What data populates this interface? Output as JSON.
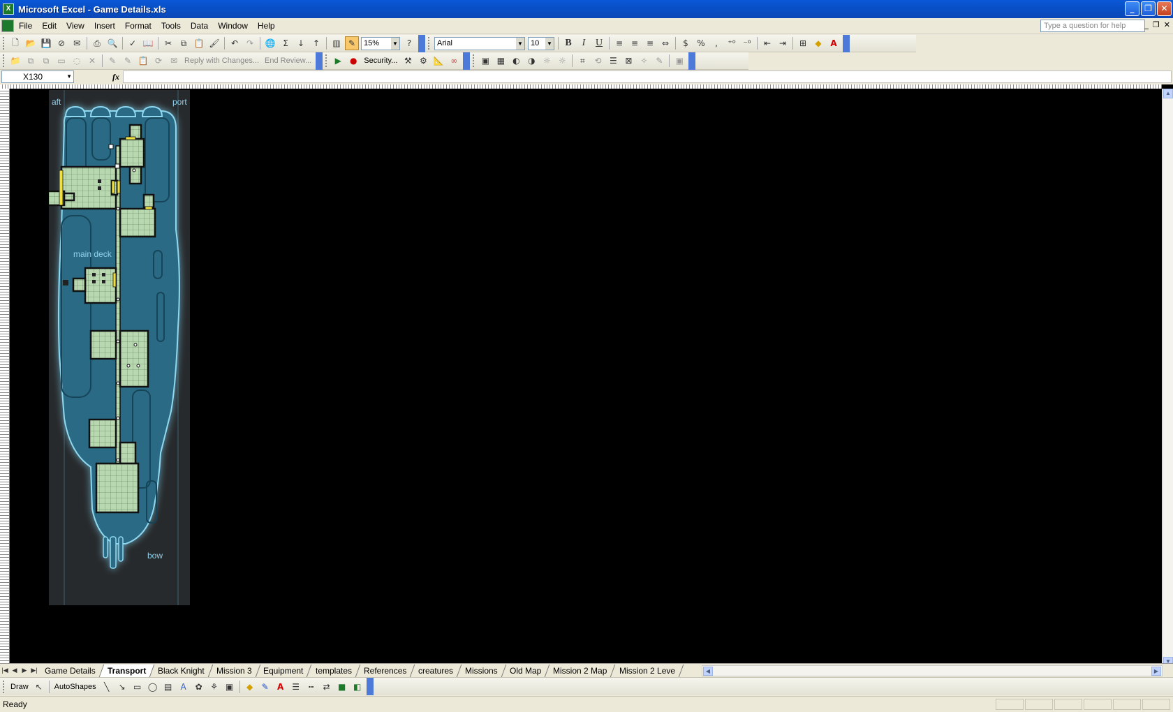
{
  "window": {
    "title": "Microsoft Excel - Game Details.xls",
    "app_icon": "X"
  },
  "menu": [
    "File",
    "Edit",
    "View",
    "Insert",
    "Format",
    "Tools",
    "Data",
    "Window",
    "Help"
  ],
  "help_placeholder": "Type a question for help",
  "standard_toolbar": {
    "zoom": "15%"
  },
  "formatting_toolbar": {
    "font": "Arial",
    "size": "10",
    "bold": "B",
    "italic": "I",
    "underline": "U",
    "percent": "%",
    "comma": ","
  },
  "reviewing_toolbar": {
    "reply": "Reply with Changes...",
    "end_review": "End Review...",
    "security": "Security..."
  },
  "formula_bar": {
    "name_box": "X130",
    "fx": "fx",
    "formula": ""
  },
  "map": {
    "label_aft": "aft",
    "label_port": "port",
    "label_deck": "main deck",
    "label_bow": "bow"
  },
  "sheet_tabs": [
    "Game Details",
    "Transport",
    "Black Knight",
    "Mission 3",
    "Equipment",
    "templates",
    "References",
    "creatures",
    "Missions",
    "Old Map",
    "Mission 2 Map",
    "Mission 2 Leve"
  ],
  "active_tab_index": 1,
  "drawing_toolbar": {
    "draw": "Draw",
    "autoshapes": "AutoShapes"
  },
  "status": "Ready",
  "colors": {
    "title_bar": "#0a58d8",
    "sheet_background": "#000000",
    "ship_hull": "#2a6a84",
    "ship_glow": "#8fd8f0",
    "room_floor": "#b8d8b0",
    "hatch": "#f0e040"
  }
}
